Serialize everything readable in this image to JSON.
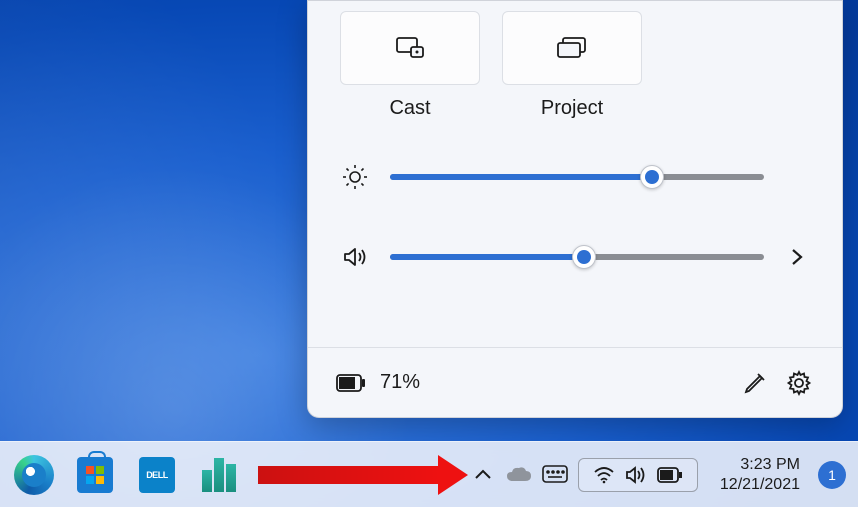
{
  "quick_settings": {
    "tiles": {
      "cast": {
        "label": "Cast"
      },
      "project": {
        "label": "Project"
      }
    },
    "brightness": {
      "value": 70,
      "tooltip": "70"
    },
    "volume": {
      "value": 52
    },
    "battery": {
      "percent_label": "71%"
    }
  },
  "taskbar": {
    "time": "3:23 PM",
    "date": "12/21/2021",
    "notification_count": "1"
  },
  "colors": {
    "accent": "#2d6fd2"
  }
}
